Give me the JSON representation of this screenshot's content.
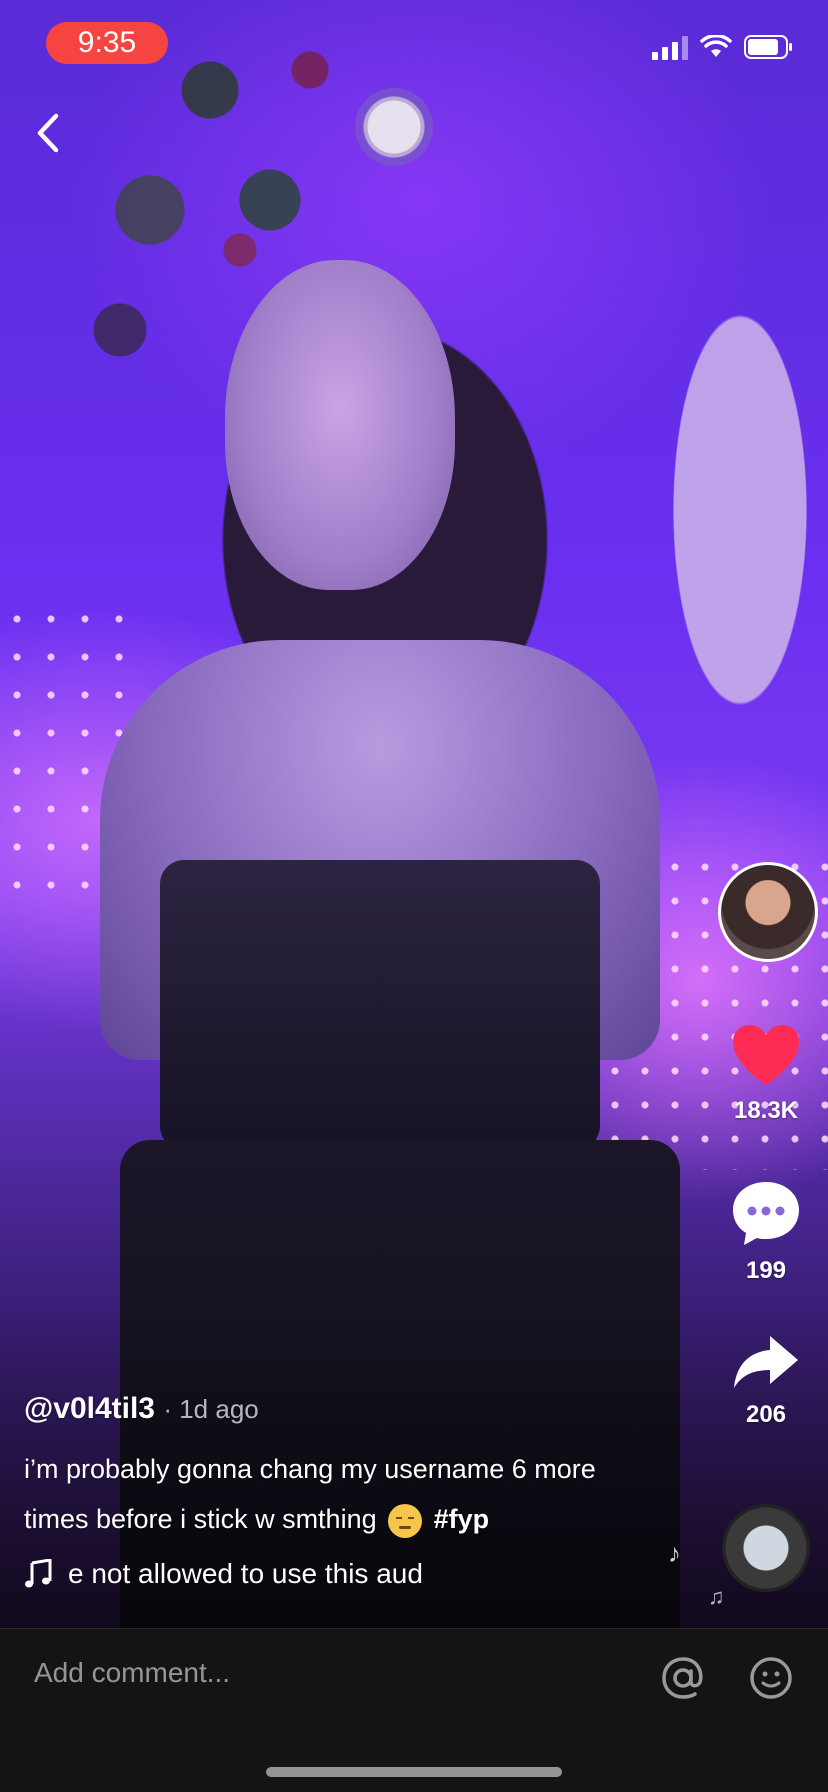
{
  "status_bar": {
    "time": "9:35"
  },
  "video": {
    "like_count": "18.3K",
    "comment_count": "199",
    "share_count": "206"
  },
  "caption": {
    "username": "@v0l4til3",
    "time_ago": "· 1d ago",
    "description": "i’m probably gonna chang my username 6 more times before i stick w smthing",
    "hashtag": "#fyp",
    "sound": "e not allowed to use this aud"
  },
  "comment_bar": {
    "placeholder": "Add comment..."
  },
  "colors": {
    "like": "#fe2c55",
    "status_time_bg": "#f64541",
    "comment_bar_bg": "#141414"
  },
  "icons": [
    "back-chevron-icon",
    "heart-icon",
    "comment-bubble-icon",
    "share-arrow-icon",
    "music-note-icon",
    "at-icon",
    "emoji-icon"
  ]
}
